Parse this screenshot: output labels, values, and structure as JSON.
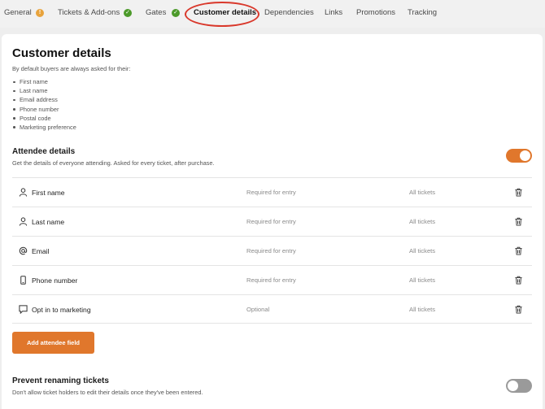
{
  "tabs": [
    {
      "label": "General",
      "status": "warning",
      "status_glyph": "!"
    },
    {
      "label": "Tickets & Add-ons",
      "status": "complete",
      "status_glyph": "✓"
    },
    {
      "label": "Gates",
      "status": "complete",
      "status_glyph": "✓"
    },
    {
      "label": "Customer details",
      "status": "active"
    },
    {
      "label": "Dependencies"
    },
    {
      "label": "Links"
    },
    {
      "label": "Promotions"
    },
    {
      "label": "Tracking"
    }
  ],
  "colors": {
    "accent": "#e0772c",
    "success": "#4c9a2a",
    "warning": "#e8a33c",
    "highlight_circle": "#d9382b"
  },
  "page": {
    "title": "Customer details",
    "intro": "By default buyers are always asked for their:",
    "default_fields": [
      "First name",
      "Last name",
      "Email address",
      "Phone number",
      "Postal code",
      "Marketing preference"
    ]
  },
  "attendee": {
    "title": "Attendee details",
    "description": "Get the details of everyone attending. Asked for every ticket, after purchase.",
    "enabled": true,
    "fields": [
      {
        "icon": "person-icon",
        "name": "First name",
        "requirement": "Required for entry",
        "tickets": "All tickets"
      },
      {
        "icon": "person-icon",
        "name": "Last name",
        "requirement": "Required for entry",
        "tickets": "All tickets"
      },
      {
        "icon": "at-icon",
        "name": "Email",
        "requirement": "Required for entry",
        "tickets": "All tickets"
      },
      {
        "icon": "phone-icon",
        "name": "Phone number",
        "requirement": "Required for entry",
        "tickets": "All tickets"
      },
      {
        "icon": "opt-in-icon",
        "name": "Opt in to marketing",
        "requirement": "Optional",
        "tickets": "All tickets"
      }
    ],
    "add_button": "Add attendee field"
  },
  "renaming": {
    "title": "Prevent renaming tickets",
    "description": "Don't allow ticket holders to edit their details once they've been entered.",
    "enabled": false
  }
}
